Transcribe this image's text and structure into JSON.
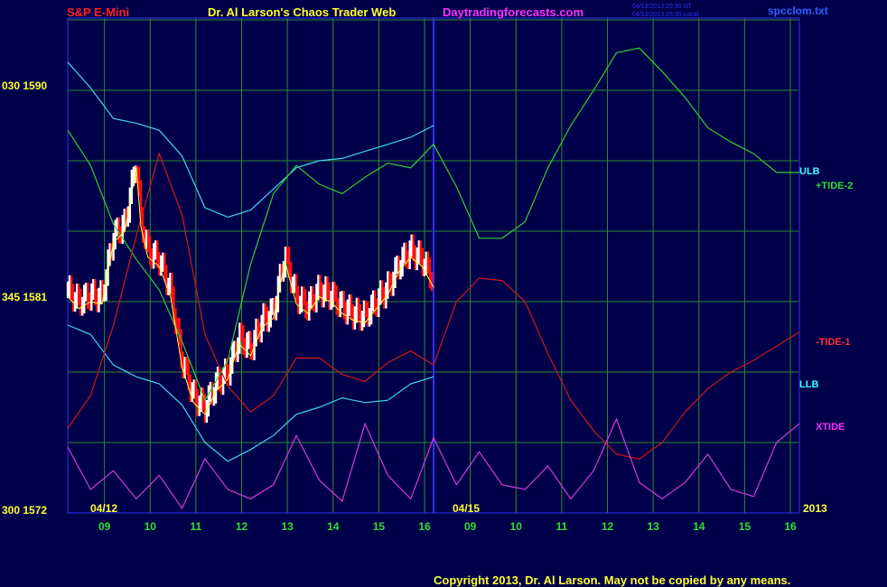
{
  "header": {
    "symbol": "S&P E-Mini",
    "title": "Dr. Al Larson's Chaos Trader Web",
    "site": "Daytradingforecasts.com",
    "stamp_ut": "04/12/2013 20:30 UT",
    "stamp_local": "04/12/2013 15:30 Local",
    "file": "spcclom.txt"
  },
  "footer": {
    "copyright": "Copyright 2013, Dr. Al Larson. May not be copied by any means."
  },
  "colors": {
    "background": "#00004a",
    "grid": "#2c8a2c",
    "price_up": "#ffffff",
    "price_down": "#ff1010",
    "ulb_llb": "#3fd6f2",
    "tide2": "#30d030",
    "tide1": "#d01818",
    "xtide": "#d838d8",
    "ma": "#ffff40",
    "divider": "#3030ff",
    "accent_red": "#ff2020",
    "accent_yellow": "#ffff30",
    "accent_magenta": "#ff30ff",
    "accent_cyan": "#40ffff"
  },
  "chart_data": {
    "type": "line",
    "title": "S&P E-Mini",
    "ylim": [
      1572,
      1593
    ],
    "y_ticks": [
      {
        "label": "030  1590",
        "value": 1590
      },
      {
        "label": "345  1581",
        "value": 1581
      },
      {
        "label": "300  1572",
        "value": 1572
      }
    ],
    "x_ticks": [
      "09",
      "10",
      "11",
      "12",
      "13",
      "14",
      "15",
      "16",
      "09",
      "10",
      "11",
      "12",
      "13",
      "14",
      "15",
      "16"
    ],
    "x_range_hours": [
      0,
      16
    ],
    "date_labels": [
      "04/12",
      "04/15",
      "2013"
    ],
    "legend": [
      "ULB",
      "+TIDE-2",
      "-TIDE-1",
      "LLB",
      "XTIDE"
    ],
    "series": [
      {
        "name": "ULB",
        "x": [
          0,
          0.5,
          1,
          1.5,
          2,
          2.5,
          3,
          3.5,
          4,
          4.5,
          5,
          5.5,
          6,
          6.5,
          7,
          7.5,
          8
        ],
        "values": [
          1591.2,
          1590.1,
          1588.8,
          1588.6,
          1588.3,
          1587.2,
          1585.0,
          1584.6,
          1584.9,
          1585.8,
          1586.7,
          1587.0,
          1587.1,
          1587.4,
          1587.7,
          1588.0,
          1588.5
        ]
      },
      {
        "name": "LLB",
        "x": [
          0,
          0.5,
          1,
          1.5,
          2,
          2.5,
          3,
          3.5,
          4,
          4.5,
          5,
          5.5,
          6,
          6.5,
          7,
          7.5,
          8
        ],
        "values": [
          1580.0,
          1579.6,
          1578.3,
          1577.8,
          1577.5,
          1576.6,
          1575.0,
          1574.2,
          1574.7,
          1575.3,
          1576.2,
          1576.5,
          1576.9,
          1576.7,
          1576.8,
          1577.5,
          1577.8
        ]
      },
      {
        "name": "+TIDE-2",
        "x": [
          0,
          0.5,
          1,
          1.5,
          2,
          2.5,
          3,
          3.5,
          4,
          4.5,
          5,
          5.5,
          6,
          6.5,
          7,
          7.5,
          8,
          8.5,
          9,
          9.5,
          10,
          10.5,
          11,
          11.5,
          12,
          12.5,
          13,
          13.5,
          14,
          14.5,
          15,
          15.5,
          16
        ],
        "values": [
          1588.3,
          1586.8,
          1584.3,
          1582.8,
          1581.5,
          1579.3,
          1576.8,
          1578.5,
          1582.6,
          1585.6,
          1586.8,
          1586.0,
          1585.6,
          1586.3,
          1586.9,
          1586.7,
          1587.7,
          1585.9,
          1583.7,
          1583.7,
          1584.4,
          1586.7,
          1588.5,
          1590.0,
          1591.6,
          1591.8,
          1590.8,
          1589.7,
          1588.4,
          1587.8,
          1587.3,
          1586.5,
          1586.5
        ]
      },
      {
        "name": "-TIDE-1",
        "x": [
          0,
          0.5,
          1,
          1.5,
          2,
          2.5,
          3,
          3.5,
          4,
          4.5,
          5,
          5.5,
          6,
          6.5,
          7,
          7.5,
          8,
          8.5,
          9,
          9.5,
          10,
          10.5,
          11,
          11.5,
          12,
          12.5,
          13,
          13.5,
          14,
          14.5,
          15,
          15.5,
          16
        ],
        "values": [
          1575.6,
          1577.0,
          1580.0,
          1583.8,
          1587.3,
          1584.7,
          1579.6,
          1577.4,
          1576.3,
          1577.0,
          1578.6,
          1578.6,
          1577.9,
          1577.6,
          1578.4,
          1578.9,
          1578.3,
          1581.0,
          1582.0,
          1581.9,
          1581.0,
          1578.8,
          1576.8,
          1575.5,
          1574.5,
          1574.3,
          1575.0,
          1576.3,
          1577.3,
          1578.0,
          1578.5,
          1579.1,
          1579.7
        ]
      },
      {
        "name": "XTIDE",
        "x": [
          0,
          0.5,
          1,
          1.5,
          2,
          2.5,
          3,
          3.5,
          4,
          4.5,
          5,
          5.5,
          6,
          6.5,
          7,
          7.5,
          8,
          8.5,
          9,
          9.5,
          10,
          10.5,
          11,
          11.5,
          12,
          12.5,
          13,
          13.5,
          14,
          14.5,
          15,
          15.5,
          16
        ],
        "values": [
          1574.8,
          1573.0,
          1573.8,
          1572.6,
          1573.6,
          1572.2,
          1574.3,
          1573.0,
          1572.6,
          1573.2,
          1575.3,
          1573.4,
          1572.5,
          1575.8,
          1573.6,
          1572.6,
          1575.2,
          1573.2,
          1574.6,
          1573.2,
          1573.0,
          1574.0,
          1572.6,
          1573.8,
          1576.0,
          1573.3,
          1572.6,
          1573.3,
          1574.5,
          1573.0,
          1572.7,
          1575.0,
          1575.8
        ]
      },
      {
        "name": "price",
        "x": [
          0,
          0.25,
          0.5,
          0.75,
          1,
          1.25,
          1.5,
          1.6,
          1.75,
          2,
          2.25,
          2.5,
          2.75,
          3,
          3.25,
          3.5,
          3.75,
          4,
          4.25,
          4.5,
          4.75,
          5,
          5.25,
          5.5,
          5.75,
          6,
          6.25,
          6.5,
          6.75,
          7,
          7.25,
          7.5,
          7.75,
          8
        ],
        "values": [
          1581.5,
          1581.0,
          1581.3,
          1581.2,
          1583.8,
          1584.3,
          1587.0,
          1584.5,
          1583.2,
          1582.8,
          1581.5,
          1578.5,
          1577.0,
          1576.5,
          1577.5,
          1578.0,
          1579.5,
          1579.0,
          1580.2,
          1580.6,
          1583.0,
          1581.2,
          1580.8,
          1581.5,
          1581.3,
          1580.8,
          1580.5,
          1580.4,
          1581.0,
          1581.6,
          1582.6,
          1583.2,
          1582.8,
          1581.9
        ]
      }
    ]
  }
}
